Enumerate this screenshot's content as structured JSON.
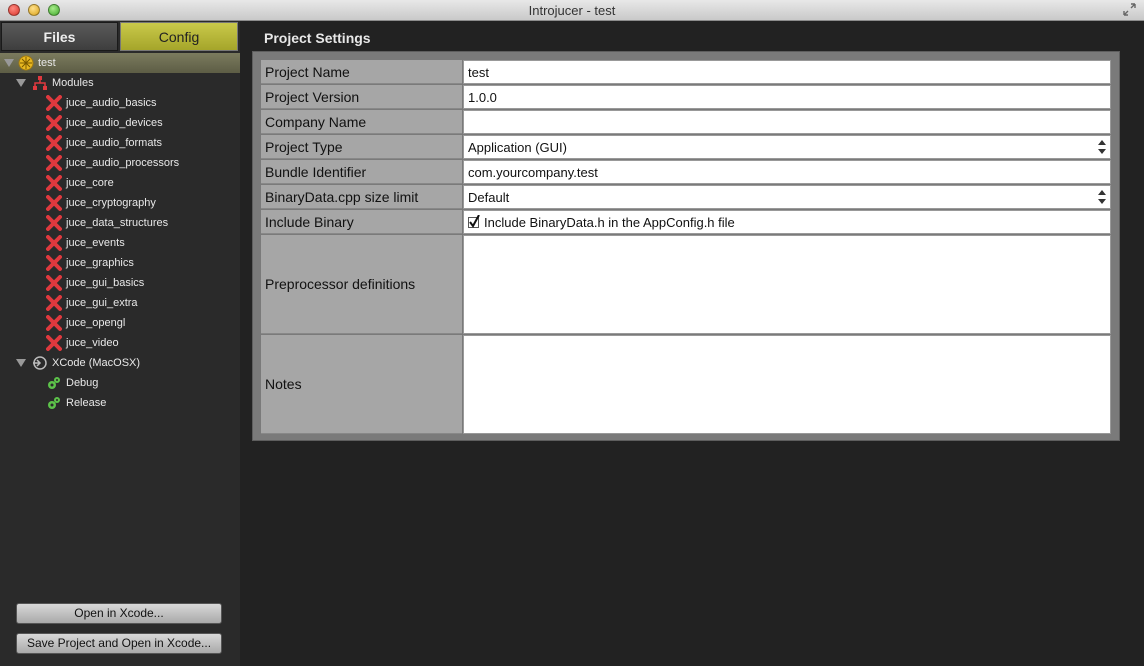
{
  "window": {
    "title": "Introjucer - test"
  },
  "sidebar": {
    "tabs": [
      {
        "label": "Files",
        "active": false
      },
      {
        "label": "Config",
        "active": true
      }
    ],
    "root": {
      "label": "test"
    },
    "modules": {
      "label": "Modules",
      "items": [
        "juce_audio_basics",
        "juce_audio_devices",
        "juce_audio_formats",
        "juce_audio_processors",
        "juce_core",
        "juce_cryptography",
        "juce_data_structures",
        "juce_events",
        "juce_graphics",
        "juce_gui_basics",
        "juce_gui_extra",
        "juce_opengl",
        "juce_video"
      ]
    },
    "exporter": {
      "label": "XCode (MacOSX)",
      "configs": [
        "Debug",
        "Release"
      ]
    },
    "buttons": {
      "open": "Open in Xcode...",
      "save_open": "Save Project and Open in Xcode..."
    }
  },
  "settings": {
    "title": "Project Settings",
    "rows": [
      {
        "label": "Project Name",
        "value": "test",
        "type": "text"
      },
      {
        "label": "Project Version",
        "value": "1.0.0",
        "type": "text"
      },
      {
        "label": "Company Name",
        "value": "",
        "type": "text"
      },
      {
        "label": "Project Type",
        "value": "Application (GUI)",
        "type": "select"
      },
      {
        "label": "Bundle Identifier",
        "value": "com.yourcompany.test",
        "type": "text"
      },
      {
        "label": "BinaryData.cpp size limit",
        "value": "Default",
        "type": "select"
      },
      {
        "label": "Include Binary",
        "value": "Include BinaryData.h in the AppConfig.h file",
        "type": "checkbox",
        "checked": true
      },
      {
        "label": "Preprocessor definitions",
        "value": "",
        "type": "textarea"
      },
      {
        "label": "Notes",
        "value": "",
        "type": "textarea"
      }
    ]
  },
  "colors": {
    "config_tab": "#b8b83a",
    "module_icon": "#e0393e",
    "config_icon": "#5cc24a"
  }
}
